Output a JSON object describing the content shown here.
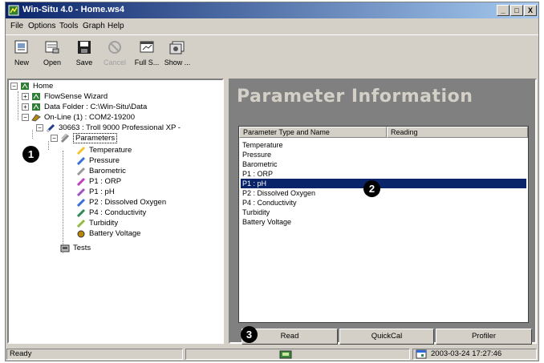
{
  "window": {
    "title": "Win-Situ 4.0 - Home.ws4",
    "buttons": [
      "_",
      "□",
      "X"
    ]
  },
  "menu": [
    "File",
    "Options",
    "Tools",
    "Graph",
    "Help"
  ],
  "toolbar": [
    {
      "label": "New",
      "icon": "new-file-icon",
      "enabled": true
    },
    {
      "label": "Open",
      "icon": "open-folder-icon",
      "enabled": true
    },
    {
      "label": "Save",
      "icon": "save-disk-icon",
      "enabled": true
    },
    {
      "label": "Cancel",
      "icon": "cancel-icon",
      "enabled": false
    },
    {
      "label": "Full S...",
      "icon": "full-screen-icon",
      "enabled": true
    },
    {
      "label": "Show ...",
      "icon": "show-icon",
      "enabled": true
    }
  ],
  "tree": {
    "home": "Home",
    "flowsense": "FlowSense Wizard",
    "datafolder": "Data Folder : C:\\Win-Situ\\Data",
    "online": "On-Line (1) : COM2-19200",
    "device": "30663 : Troll 9000 Professional XP -",
    "parameters": "Parameters",
    "params": [
      "Temperature",
      "Pressure",
      "Barometric",
      "P1 : ORP",
      "P1 : pH",
      "P2 : Dissolved Oxygen",
      "P4 : Conductivity",
      "Turbidity",
      "Battery Voltage"
    ],
    "tests": "Tests"
  },
  "panel": {
    "header": "Parameter Information",
    "columns": [
      "Parameter Type and Name",
      "Reading"
    ],
    "rows": [
      "Temperature",
      "Pressure",
      "Barometric",
      "P1 : ORP",
      "P1 : pH",
      "P2 : Dissolved Oxygen",
      "P4 : Conductivity",
      "Turbidity",
      "Battery Voltage"
    ],
    "selected_index": 4,
    "buttons": {
      "read": "Read",
      "quickcal": "QuickCal",
      "profiler": "Profiler"
    }
  },
  "status": {
    "text": "Ready",
    "datetime": "2003-03-24  17:27:46"
  },
  "callouts": [
    "1",
    "2",
    "3"
  ]
}
